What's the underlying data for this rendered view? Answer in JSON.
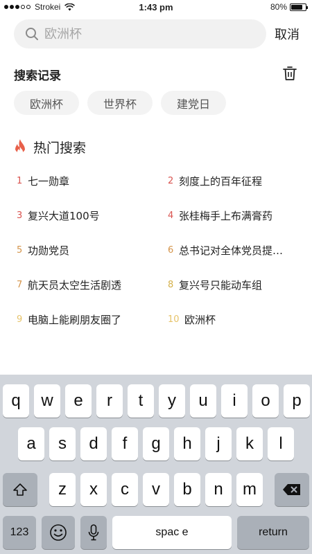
{
  "status_bar": {
    "carrier": "Strokei",
    "time": "1:43 pm",
    "battery": "80%",
    "battery_level": 0.8
  },
  "search": {
    "placeholder": "欧洲杯",
    "cancel_label": "取消"
  },
  "history": {
    "title": "搜索记录",
    "items": [
      "欧洲杯",
      "世界杯",
      "建党日"
    ]
  },
  "hot": {
    "title": "热门搜索",
    "items": [
      {
        "rank": "1",
        "text": "七一勋章",
        "color": "#d9534f"
      },
      {
        "rank": "2",
        "text": "刻度上的百年征程",
        "color": "#d9534f"
      },
      {
        "rank": "3",
        "text": "复兴大道100号",
        "color": "#d9534f"
      },
      {
        "rank": "4",
        "text": "张桂梅手上布满膏药",
        "color": "#d9534f"
      },
      {
        "rank": "5",
        "text": "功勋党员",
        "color": "#d4944a"
      },
      {
        "rank": "6",
        "text": "总书记对全体党员提…",
        "color": "#d4944a"
      },
      {
        "rank": "7",
        "text": "航天员太空生活剧透",
        "color": "#d4944a"
      },
      {
        "rank": "8",
        "text": "复兴号只能动车组",
        "color": "#d4b04a"
      },
      {
        "rank": "9",
        "text": "电脑上能刷朋友圈了",
        "color": "#e6c36a"
      },
      {
        "rank": "10",
        "text": "欧洲杯",
        "color": "#e6c36a"
      }
    ]
  },
  "keyboard": {
    "row1": [
      "q",
      "w",
      "e",
      "r",
      "t",
      "y",
      "u",
      "i",
      "o",
      "p"
    ],
    "row2": [
      "a",
      "s",
      "d",
      "f",
      "g",
      "h",
      "j",
      "k",
      "l"
    ],
    "row3": [
      "z",
      "x",
      "c",
      "v",
      "b",
      "n",
      "m"
    ],
    "numbers_label": "123",
    "space_label": "spac e",
    "return_label": "return"
  }
}
